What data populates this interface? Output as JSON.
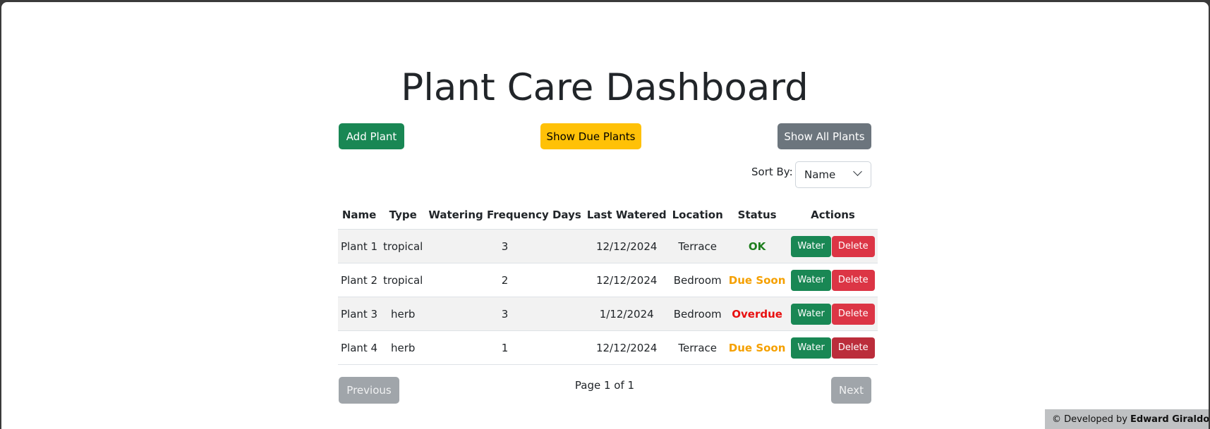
{
  "header": {
    "title": "Plant Care Dashboard"
  },
  "toolbar": {
    "add_label": "Add Plant",
    "due_label": "Show Due Plants",
    "all_label": "Show All Plants"
  },
  "sort": {
    "label": "Sort By:",
    "selected": "Name"
  },
  "table": {
    "headers": [
      "Name",
      "Type",
      "Watering Frequency Days",
      "Last Watered",
      "Location",
      "Status",
      "Actions"
    ],
    "rows": [
      {
        "name": "Plant 1",
        "type": "tropical",
        "frequency": "3",
        "last_watered": "12/12/2024",
        "location": "Terrace",
        "status": "OK"
      },
      {
        "name": "Plant 2",
        "type": "tropical",
        "frequency": "2",
        "last_watered": "12/12/2024",
        "location": "Bedroom",
        "status": "Due Soon"
      },
      {
        "name": "Plant 3",
        "type": "herb",
        "frequency": "3",
        "last_watered": "1/12/2024",
        "location": "Bedroom",
        "status": "Overdue"
      },
      {
        "name": "Plant 4",
        "type": "herb",
        "frequency": "1",
        "last_watered": "12/12/2024",
        "location": "Terrace",
        "status": "Due Soon"
      }
    ],
    "water_label": "Water",
    "delete_label": "Delete"
  },
  "status_colors": {
    "OK": "#1e7e1e",
    "Due Soon": "#f5a000",
    "Overdue": "#e81010"
  },
  "pagination": {
    "prev_label": "Previous",
    "page_info": "Page 1 of 1",
    "next_label": "Next"
  },
  "footer": {
    "prefix": "© Developed by",
    "author": "Edward Giraldo"
  }
}
